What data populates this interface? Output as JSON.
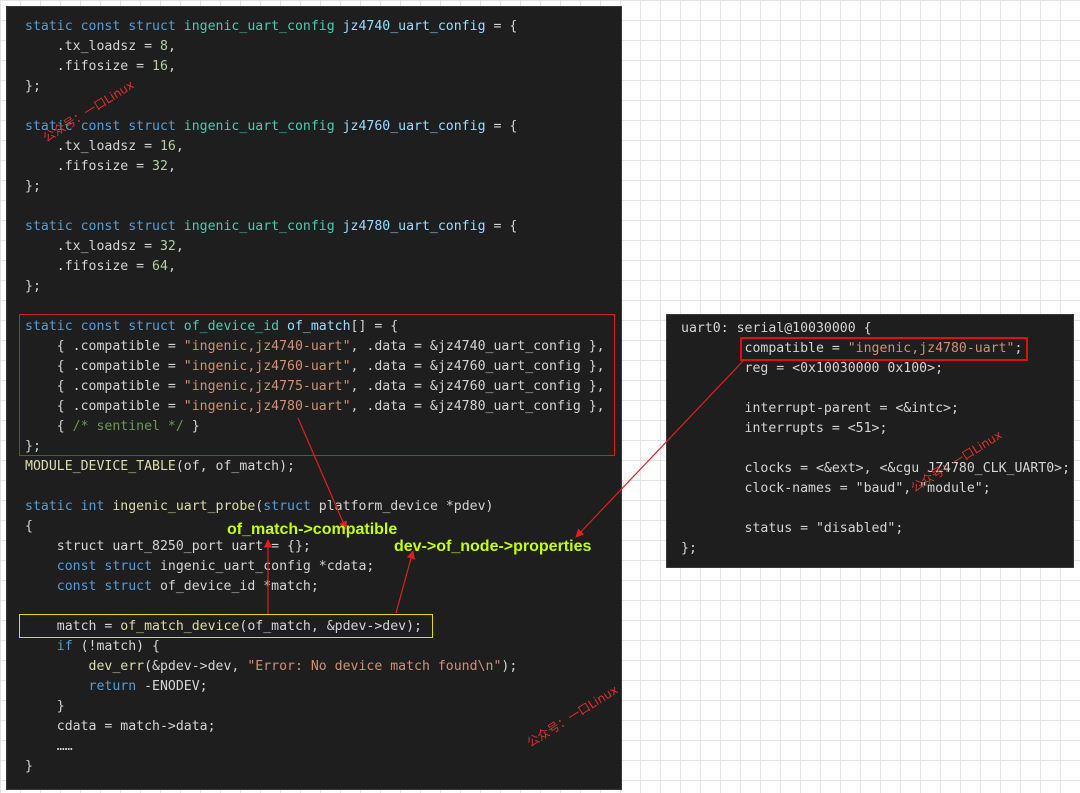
{
  "left_code": [
    [
      [
        "static const struct ",
        "kw"
      ],
      [
        "ingenic_uart_config ",
        "ty"
      ],
      [
        "jz4740_uart_config",
        "var"
      ],
      [
        " = {",
        "p"
      ]
    ],
    [
      [
        "    .tx_loadsz = ",
        "p"
      ],
      [
        "8",
        "num"
      ],
      [
        ",",
        "p"
      ]
    ],
    [
      [
        "    .fifosize = ",
        "p"
      ],
      [
        "16",
        "num"
      ],
      [
        ",",
        "p"
      ]
    ],
    [
      [
        "};",
        "p"
      ]
    ],
    [],
    [
      [
        "static const struct ",
        "kw"
      ],
      [
        "ingenic_uart_config ",
        "ty"
      ],
      [
        "jz4760_uart_config",
        "var"
      ],
      [
        " = {",
        "p"
      ]
    ],
    [
      [
        "    .tx_loadsz = ",
        "p"
      ],
      [
        "16",
        "num"
      ],
      [
        ",",
        "p"
      ]
    ],
    [
      [
        "    .fifosize = ",
        "p"
      ],
      [
        "32",
        "num"
      ],
      [
        ",",
        "p"
      ]
    ],
    [
      [
        "};",
        "p"
      ]
    ],
    [],
    [
      [
        "static const struct ",
        "kw"
      ],
      [
        "ingenic_uart_config ",
        "ty"
      ],
      [
        "jz4780_uart_config",
        "var"
      ],
      [
        " = {",
        "p"
      ]
    ],
    [
      [
        "    .tx_loadsz = ",
        "p"
      ],
      [
        "32",
        "num"
      ],
      [
        ",",
        "p"
      ]
    ],
    [
      [
        "    .fifosize = ",
        "p"
      ],
      [
        "64",
        "num"
      ],
      [
        ",",
        "p"
      ]
    ],
    [
      [
        "};",
        "p"
      ]
    ],
    [],
    [
      [
        "static const struct ",
        "kw"
      ],
      [
        "of_device_id ",
        "ty"
      ],
      [
        "of_match",
        "var"
      ],
      [
        "[] = {",
        "p"
      ]
    ],
    [
      [
        "    { .compatible = ",
        "p"
      ],
      [
        "\"ingenic,jz4740-uart\"",
        "str"
      ],
      [
        ", .data = &jz4740_uart_config },",
        "p"
      ]
    ],
    [
      [
        "    { .compatible = ",
        "p"
      ],
      [
        "\"ingenic,jz4760-uart\"",
        "str"
      ],
      [
        ", .data = &jz4760_uart_config },",
        "p"
      ]
    ],
    [
      [
        "    { .compatible = ",
        "p"
      ],
      [
        "\"ingenic,jz4775-uart\"",
        "str"
      ],
      [
        ", .data = &jz4760_uart_config },",
        "p"
      ]
    ],
    [
      [
        "    { .compatible = ",
        "p"
      ],
      [
        "\"ingenic,jz4780-uart\"",
        "str"
      ],
      [
        ", .data = &jz4780_uart_config },",
        "p"
      ]
    ],
    [
      [
        "    { ",
        "p"
      ],
      [
        "/* sentinel */",
        "cm"
      ],
      [
        " }",
        "p"
      ]
    ],
    [
      [
        "};",
        "p"
      ]
    ],
    [
      [
        "MODULE_DEVICE_TABLE",
        "fn"
      ],
      [
        "(of, of_match);",
        "p"
      ]
    ],
    [],
    [
      [
        "static int ",
        "kw"
      ],
      [
        "ingenic_uart_probe",
        "fn"
      ],
      [
        "(",
        "p"
      ],
      [
        "struct ",
        "kw"
      ],
      [
        "platform_device *pdev)",
        "p"
      ]
    ],
    [
      [
        "{",
        "p"
      ]
    ],
    [
      [
        "    struct uart_8250_port uart = {};",
        "p"
      ]
    ],
    [
      [
        "    const struct ",
        "kw"
      ],
      [
        "ingenic_uart_config *cdata;",
        "p"
      ]
    ],
    [
      [
        "    const struct ",
        "kw"
      ],
      [
        "of_device_id *match;",
        "p"
      ]
    ],
    [],
    [
      [
        "    match = ",
        "p"
      ],
      [
        "of_match_device",
        "fn"
      ],
      [
        "(of_match, &pdev->dev);",
        "p"
      ]
    ],
    [
      [
        "    if ",
        "kw"
      ],
      [
        "(!match) {",
        "p"
      ]
    ],
    [
      [
        "        dev_err",
        "fn"
      ],
      [
        "(&pdev->dev, ",
        "p"
      ],
      [
        "\"Error: No device match found\\n\"",
        "str"
      ],
      [
        ");",
        "p"
      ]
    ],
    [
      [
        "        return ",
        "kw"
      ],
      [
        "-ENODEV;",
        "p"
      ]
    ],
    [
      [
        "    }",
        "p"
      ]
    ],
    [
      [
        "    cdata = match->data;",
        "p"
      ]
    ],
    [
      [
        "    ……",
        "p"
      ]
    ],
    [
      [
        "}",
        "p"
      ]
    ]
  ],
  "right_code": [
    [
      [
        "uart0: serial@10030000 {",
        "p"
      ]
    ],
    [
      [
        "        compatible = ",
        "p"
      ],
      [
        "\"ingenic,jz4780-uart\"",
        "str"
      ],
      [
        ";",
        "p"
      ]
    ],
    [
      [
        "        reg = <0x10030000 0x100>;",
        "p"
      ]
    ],
    [],
    [
      [
        "        interrupt-parent = <&intc>;",
        "p"
      ]
    ],
    [
      [
        "        interrupts = <51>;",
        "p"
      ]
    ],
    [],
    [
      [
        "        clocks = <&ext>, <&cgu JZ4780_CLK_UART0>;",
        "p"
      ]
    ],
    [
      [
        "        clock-names = \"baud\", \"module\";",
        "p"
      ]
    ],
    [],
    [
      [
        "        status = \"disabled\";",
        "p"
      ]
    ],
    [
      [
        "};",
        "p"
      ]
    ]
  ],
  "annotations": {
    "of_match_compatible": "of_match->compatible",
    "dev_of_node_properties": "dev->of_node->properties"
  },
  "watermark": "公众号：一口Linux",
  "colors": {
    "background": "#ffffff",
    "panel": "#1e1e1e",
    "annotation": "#c2ff0a",
    "highlight_red": "#d01f1f",
    "highlight_yellow": "#e6d800",
    "arrow": "#e02020"
  }
}
